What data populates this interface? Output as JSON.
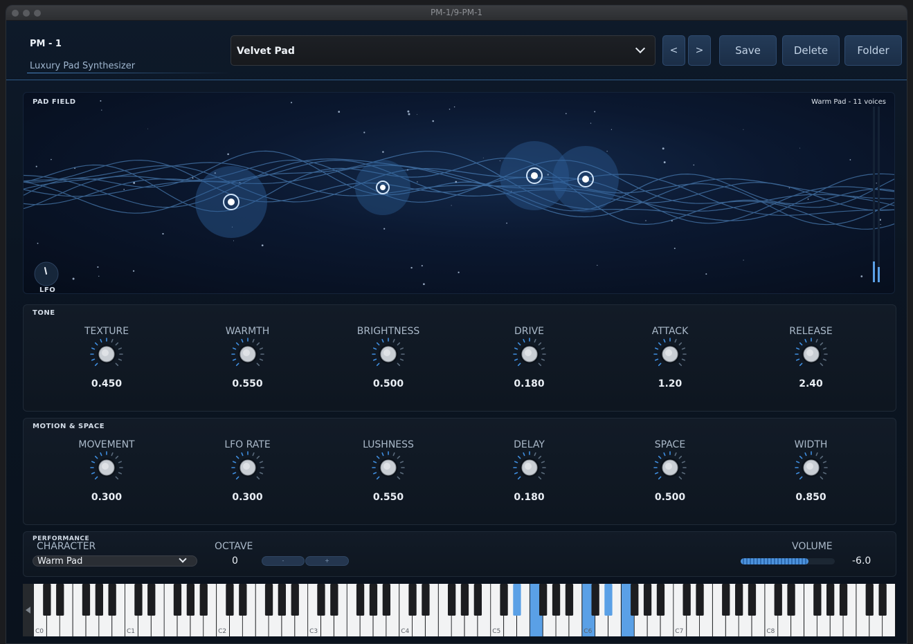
{
  "window": {
    "title": "PM-1/9-PM-1"
  },
  "header": {
    "app_name": "PM - 1",
    "subtitle": "Luxury Pad Synthesizer",
    "preset": "Velvet Pad",
    "prev_label": "<",
    "next_label": ">",
    "save_label": "Save",
    "delete_label": "Delete",
    "folder_label": "Folder"
  },
  "pad_field": {
    "label": "PAD FIELD",
    "info": "Warm Pad  -  11 voices",
    "lfo_label": "LFO",
    "level_meter": [
      0.3,
      0.22
    ]
  },
  "tone": {
    "label": "TONE",
    "knobs": [
      {
        "label": "TEXTURE",
        "value": "0.450"
      },
      {
        "label": "WARMTH",
        "value": "0.550"
      },
      {
        "label": "BRIGHTNESS",
        "value": "0.500"
      },
      {
        "label": "DRIVE",
        "value": "0.180"
      },
      {
        "label": "ATTACK",
        "value": "1.20"
      },
      {
        "label": "RELEASE",
        "value": "2.40"
      }
    ]
  },
  "motion": {
    "label": "MOTION  &  SPACE",
    "knobs": [
      {
        "label": "MOVEMENT",
        "value": "0.300"
      },
      {
        "label": "LFO RATE",
        "value": "0.300"
      },
      {
        "label": "LUSHNESS",
        "value": "0.550"
      },
      {
        "label": "DELAY",
        "value": "0.180"
      },
      {
        "label": "SPACE",
        "value": "0.500"
      },
      {
        "label": "WIDTH",
        "value": "0.850"
      }
    ]
  },
  "performance": {
    "label": "PERFORMANCE",
    "character_label": "CHARACTER",
    "character_value": "Warm Pad",
    "octave_label": "OCTAVE",
    "octave_value": "0",
    "octave_down": "-",
    "octave_up": "+",
    "volume_label": "VOLUME",
    "volume_value": "-6.0",
    "volume_level": 0.72
  },
  "keyboard": {
    "octave_labels": [
      "C0",
      "C1",
      "C2",
      "C3",
      "C4",
      "C5",
      "C6",
      "C7",
      "C8"
    ],
    "highlight_color": "#5aa0e6"
  },
  "colors": {
    "accent": "#4a86c4",
    "knob_tick": "#3f8ee0"
  }
}
